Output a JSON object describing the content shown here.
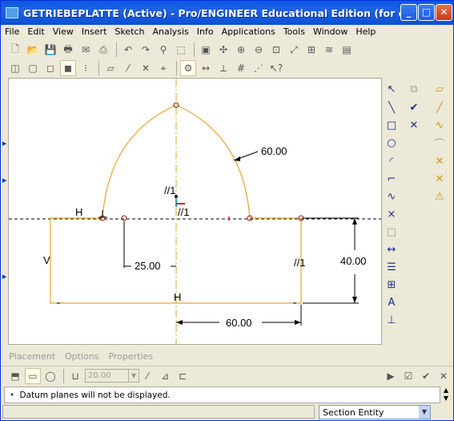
{
  "window": {
    "title": "GETRIEBEPLATTE (Active) - Pro/ENGINEER Educational Edition (for educatio...",
    "minimize_glyph": "_",
    "maximize_glyph": "□",
    "close_glyph": "✕"
  },
  "menubar": {
    "items": [
      "File",
      "Edit",
      "View",
      "Insert",
      "Sketch",
      "Analysis",
      "Info",
      "Applications",
      "Tools",
      "Window",
      "Help"
    ]
  },
  "canvas": {
    "dim_60_arc": "60.00",
    "dim_25": "25.00",
    "dim_40": "40.00",
    "dim_60_bottom": "60.00",
    "constraint_h_top": "H",
    "constraint_v": "V",
    "constraint_h_bottom": "H",
    "parallel_1_top": "//1",
    "parallel_1_mid": "//1",
    "parallel_1_right": "//1",
    "sketch_color": "#e8a52b",
    "dimension_color": "#000000"
  },
  "dashboard": {
    "tabs": [
      "Placement",
      "Options",
      "Properties"
    ],
    "thickness_value": "20.00"
  },
  "message_area": {
    "message": "Datum planes will not be displayed."
  },
  "statusbar": {
    "filter_value": "Section Entity"
  }
}
